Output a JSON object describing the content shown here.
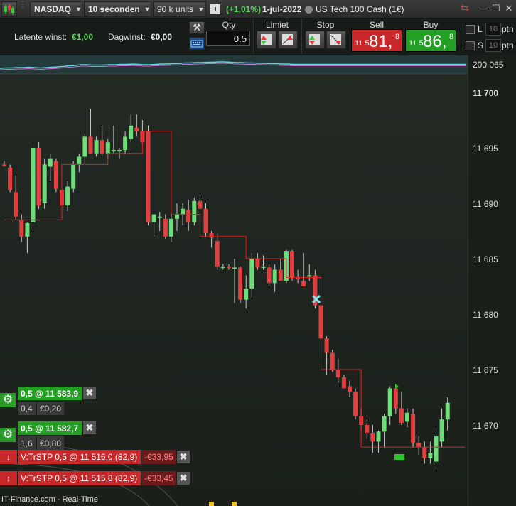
{
  "toolbar": {
    "market": "NASDAQ",
    "interval": "10 seconden",
    "units": "90 k units",
    "change": "(+1,01%)",
    "date": "1-jul-2022",
    "instrument": "US Tech 100 Cash (1€)",
    "colors": {
      "change": "#5ad35a"
    }
  },
  "panel": {
    "latent_label": "Latente winst:",
    "latent_value": "€1,00",
    "day_label": "Dagwinst:",
    "day_value": "€0,00",
    "qty_label": "Qty",
    "qty_value": "0.5",
    "limit_label": "Limiet",
    "stop_label": "Stop",
    "sell_label": "Sell",
    "buy_label": "Buy",
    "sell_small": "11 5",
    "sell_big": "81,",
    "sell_sup": "8",
    "buy_small": "11 5",
    "buy_big": "86,",
    "buy_sup": "8",
    "l_label": "L",
    "s_label": "S",
    "l_value": "10",
    "s_value": "10",
    "ptn": "ptn",
    "colors": {
      "sell": "#c8282a",
      "buy": "#23a023"
    }
  },
  "indicator_value": "200 065",
  "axis": {
    "ticks": [
      "11 700",
      "11 695",
      "11 690",
      "11 685",
      "11 680",
      "11 675",
      "11 670"
    ]
  },
  "positions": [
    {
      "price": "0,5 @ 11 583,9",
      "qty": "0,4",
      "pnl": "€0,20"
    },
    {
      "price": "0,5 @ 11 582,7",
      "qty": "1,6",
      "pnl": "€0,80"
    }
  ],
  "stops": [
    {
      "label": "V:TrSTP  0,5 @ 11 516,0 (82,9)",
      "pnl": "-€33,95"
    },
    {
      "label": "V:TrSTP  0,5 @ 11 515,8 (82,9)",
      "pnl": "-€33,45"
    }
  ],
  "footer": "IT-Finance.com - Real-Time",
  "chart_data": {
    "type": "candlestick",
    "ylim": [
      11666,
      11702
    ],
    "candles": [
      [
        11693.5,
        11693.8,
        11693.3,
        11693.4
      ],
      [
        11693.2,
        11693.5,
        11691.0,
        11691.2
      ],
      [
        11691.0,
        11692.5,
        11688.5,
        11688.8
      ],
      [
        11688.5,
        11689.0,
        11686.5,
        11687.0
      ],
      [
        11687.0,
        11688.3,
        11685.5,
        11688.2
      ],
      [
        11688.3,
        11695.5,
        11687.5,
        11695.0
      ],
      [
        11695.0,
        11695.5,
        11689.5,
        11689.8
      ],
      [
        11690.0,
        11694.0,
        11689.5,
        11693.5
      ],
      [
        11693.3,
        11694.5,
        11692.0,
        11694.0
      ],
      [
        11693.8,
        11694.0,
        11691.0,
        11691.3
      ],
      [
        11691.2,
        11691.8,
        11689.0,
        11689.8
      ],
      [
        11689.8,
        11692.0,
        11689.3,
        11691.5
      ],
      [
        11691.3,
        11693.8,
        11691.0,
        11693.5
      ],
      [
        11693.5,
        11694.5,
        11692.8,
        11694.2
      ],
      [
        11694.2,
        11696.3,
        11693.5,
        11696.0
      ],
      [
        11696.0,
        11698.5,
        11694.5,
        11694.5
      ],
      [
        11694.5,
        11696.0,
        11694.2,
        11695.7
      ],
      [
        11695.7,
        11697.0,
        11694.3,
        11694.5
      ],
      [
        11694.5,
        11695.8,
        11694.0,
        11695.5
      ],
      [
        11694.8,
        11697.0,
        11694.5,
        11694.8
      ],
      [
        11694.8,
        11695.0,
        11694.0,
        11694.8
      ],
      [
        11694.8,
        11696.5,
        11694.5,
        11696.0
      ],
      [
        11695.8,
        11698.0,
        11695.5,
        11697.0
      ],
      [
        11696.8,
        11698.0,
        11696.0,
        11696.5
      ],
      [
        11696.5,
        11697.5,
        11695.3,
        11695.5
      ],
      [
        11696.5,
        11697.0,
        11688.0,
        11688.3
      ],
      [
        11688.3,
        11689.0,
        11687.0,
        11689.0
      ],
      [
        11688.8,
        11689.2,
        11687.5,
        11688.8
      ],
      [
        11688.6,
        11689.0,
        11686.8,
        11687.0
      ],
      [
        11687.0,
        11689.0,
        11686.5,
        11688.6
      ],
      [
        11688.6,
        11690.0,
        11687.5,
        11689.0
      ],
      [
        11689.0,
        11690.0,
        11688.0,
        11689.5
      ],
      [
        11689.4,
        11690.3,
        11687.5,
        11688.3
      ],
      [
        11688.3,
        11690.5,
        11688.0,
        11690.2
      ],
      [
        11690.2,
        11690.8,
        11689.5,
        11689.5
      ],
      [
        11689.5,
        11690.0,
        11687.0,
        11687.3
      ],
      [
        11687.3,
        11687.5,
        11686.0,
        11686.9
      ],
      [
        11686.6,
        11687.3,
        11684.0,
        11684.3
      ],
      [
        11684.3,
        11684.5,
        11684.0,
        11684.3
      ],
      [
        11684.3,
        11684.5,
        11684.0,
        11684.2
      ],
      [
        11684.2,
        11685.0,
        11681.0,
        11684.2
      ],
      [
        11684.2,
        11684.3,
        11681.0,
        11681.3
      ],
      [
        11681.3,
        11683.5,
        11680.5,
        11682.3
      ],
      [
        11682.3,
        11685.5,
        11681.5,
        11685.0
      ],
      [
        11685.0,
        11685.5,
        11684.0,
        11684.2
      ],
      [
        11684.3,
        11685.3,
        11684.0,
        11684.3
      ],
      [
        11684.2,
        11684.5,
        11682.5,
        11682.8
      ],
      [
        11682.8,
        11684.5,
        11682.0,
        11684.0
      ],
      [
        11684.0,
        11685.0,
        11683.5,
        11683.0
      ],
      [
        11683.0,
        11685.8,
        11682.8,
        11685.7
      ],
      [
        11685.7,
        11685.8,
        11683.0,
        11683.3
      ],
      [
        11683.3,
        11684.0,
        11682.8,
        11683.2
      ],
      [
        11683.0,
        11685.5,
        11682.5,
        11682.5
      ],
      [
        11683.5,
        11684.5,
        11683.0,
        11683.5
      ],
      [
        11683.5,
        11684.0,
        11680.5,
        11680.8
      ],
      [
        11680.8,
        11681.0,
        11677.5,
        11677.8
      ],
      [
        11677.8,
        11678.0,
        11674.5,
        11676.5
      ],
      [
        11676.5,
        11676.8,
        11674.8,
        11675.0
      ],
      [
        11675.0,
        11676.0,
        11673.8,
        11674.3
      ],
      [
        11674.3,
        11674.5,
        11673.5,
        11673.3
      ],
      [
        11673.5,
        11674.0,
        11672.5,
        11673.0
      ],
      [
        11673.0,
        11673.3,
        11670.5,
        11670.8
      ],
      [
        11670.8,
        11671.5,
        11669.5,
        11670.0
      ],
      [
        11670.0,
        11670.5,
        11668.8,
        11669.3
      ],
      [
        11669.3,
        11670.0,
        11667.5,
        11668.5
      ],
      [
        11668.5,
        11669.5,
        11667.5,
        11669.4
      ],
      [
        11669.4,
        11671.0,
        11668.0,
        11670.8
      ],
      [
        11670.8,
        11673.5,
        11670.0,
        11673.3
      ],
      [
        11673.3,
        11673.5,
        11671.0,
        11671.5
      ],
      [
        11671.5,
        11673.0,
        11670.0,
        11670.2
      ],
      [
        11670.3,
        11671.5,
        11669.8,
        11671.1
      ],
      [
        11671.0,
        11671.5,
        11668.0,
        11668.4
      ],
      [
        11668.4,
        11669.0,
        11667.3,
        11668.0
      ],
      [
        11668.0,
        11668.5,
        11666.5,
        11667.0
      ],
      [
        11667.0,
        11668.5,
        11666.5,
        11667.5
      ],
      [
        11666.7,
        11669.5,
        11666.0,
        11669.0
      ],
      [
        11668.5,
        11671.5,
        11668.0,
        11670.5
      ],
      [
        11670.5,
        11672.5,
        11669.5,
        11672.0
      ]
    ],
    "trail": [
      [
        0,
        11688.5
      ],
      [
        10,
        11688.5
      ],
      [
        10,
        11693.5
      ],
      [
        18,
        11693.5
      ],
      [
        18,
        11694.5
      ],
      [
        24,
        11694.5
      ],
      [
        24,
        11696.5
      ],
      [
        29,
        11696.5
      ],
      [
        29,
        11689.0
      ],
      [
        34,
        11689.0
      ],
      [
        34,
        11687.0
      ],
      [
        42,
        11687.0
      ],
      [
        42,
        11685.0
      ],
      [
        49,
        11685.0
      ],
      [
        49,
        11683.3
      ],
      [
        55,
        11683.3
      ],
      [
        55,
        11675.0
      ],
      [
        62,
        11675.0
      ],
      [
        62,
        11668.0
      ],
      [
        80,
        11668.0
      ]
    ],
    "indicator": [
      32,
      31,
      31,
      30,
      30,
      29,
      30,
      31,
      30,
      29,
      28,
      27,
      25,
      24,
      22,
      22,
      23,
      23,
      23,
      22,
      22,
      21,
      21,
      20,
      21,
      22,
      22,
      21,
      20,
      20,
      19,
      19,
      17,
      17,
      16,
      16,
      15,
      15,
      14,
      14,
      15,
      16,
      16,
      17,
      17,
      18,
      18,
      19,
      19,
      20,
      20,
      21,
      21,
      21,
      21,
      21,
      21,
      21,
      21,
      21,
      21,
      21,
      21,
      21,
      21,
      21,
      21,
      21,
      21,
      21,
      21,
      21,
      21,
      21,
      21,
      21,
      21,
      21,
      21,
      21,
      21,
      21
    ]
  }
}
